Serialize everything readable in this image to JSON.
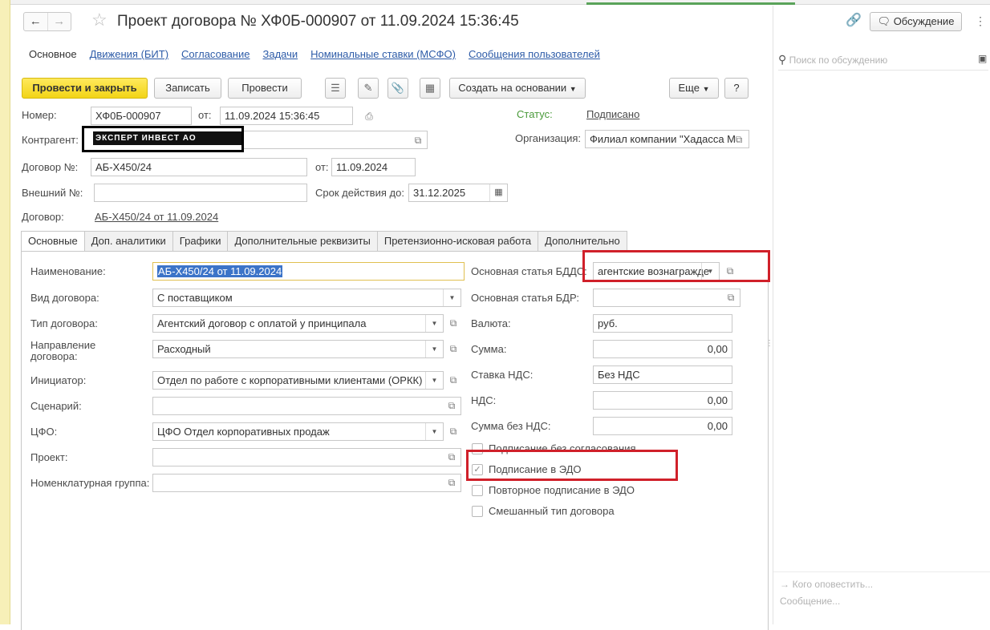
{
  "window": {
    "title": "Проект договора № ХФ0Б-000907 от 11.09.2024 15:36:45",
    "discussion_button": "Обсуждение"
  },
  "section_tabs": [
    {
      "label": "Основное"
    },
    {
      "label": "Движения (БИТ)"
    },
    {
      "label": "Согласование"
    },
    {
      "label": "Задачи"
    },
    {
      "label": "Номинальные ставки (МСФО)"
    },
    {
      "label": "Сообщения пользователей"
    }
  ],
  "toolbar": {
    "post_and_close": "Провести и закрыть",
    "save": "Записать",
    "post": "Провести",
    "create_based_on": "Создать на основании",
    "more": "Еще",
    "help": "?"
  },
  "header": {
    "number_label": "Номер:",
    "number_value": "ХФ0Б-000907",
    "from_label": "от:",
    "date_value": "11.09.2024 15:36:45",
    "status_label": "Статус:",
    "status_value": "Подписано",
    "counterparty_label": "Контрагент:",
    "counterparty_value": "ЭКСПЕРТ ИНВЕСТ АО",
    "organization_label": "Организация:",
    "organization_value": "Филиал компании \"Хадасса М",
    "contract_no_label": "Договор №:",
    "contract_no_value": "АБ-Х450/24",
    "contract_date_label": "от:",
    "contract_date_value": "11.09.2024",
    "external_no_label": "Внешний №:",
    "external_no_value": "",
    "valid_until_label": "Срок действия до:",
    "valid_until_value": "31.12.2025",
    "contract_label": "Договор:",
    "contract_link": "АБ-Х450/24 от 11.09.2024"
  },
  "form_tabs": [
    {
      "label": "Основные"
    },
    {
      "label": "Доп. аналитики"
    },
    {
      "label": "Графики"
    },
    {
      "label": "Дополнительные реквизиты"
    },
    {
      "label": "Претензионно-исковая работа"
    },
    {
      "label": "Дополнительно"
    }
  ],
  "left_fields": {
    "name_label": "Наименование:",
    "name_value": "АБ-Х450/24 от 11.09.2024",
    "kind_label": "Вид договора:",
    "kind_value": "С поставщиком",
    "type_label": "Тип договора:",
    "type_value": "Агентский договор с оплатой у принципала",
    "direction_label": "Направление договора:",
    "direction_value": "Расходный",
    "initiator_label": "Инициатор:",
    "initiator_value": "Отдел по работе с корпоративными клиентами (ОРКК)",
    "scenario_label": "Сценарий:",
    "scenario_value": "",
    "cfo_label": "ЦФО:",
    "cfo_value": "ЦФО Отдел корпоративных продаж",
    "project_label": "Проект:",
    "project_value": "",
    "nomgroup_label": "Номенклатурная группа:",
    "nomgroup_value": ""
  },
  "right_fields": {
    "bdds_label": "Основная статья БДДС:",
    "bdds_value": "агентские вознагражде",
    "bdr_label": "Основная статья БДР:",
    "bdr_value": "",
    "currency_label": "Валюта:",
    "currency_value": "руб.",
    "sum_label": "Сумма:",
    "sum_value": "0,00",
    "vat_rate_label": "Ставка НДС:",
    "vat_rate_value": "Без НДС",
    "vat_label": "НДС:",
    "vat_value": "0,00",
    "sum_no_vat_label": "Сумма без НДС:",
    "sum_no_vat_value": "0,00"
  },
  "checkboxes": [
    {
      "label": "Подписание без согласования",
      "checked": false
    },
    {
      "label": "Подписание в ЭДО",
      "checked": true
    },
    {
      "label": "Повторное подписание в ЭДО",
      "checked": false
    },
    {
      "label": "Смешанный тип договора",
      "checked": false
    }
  ],
  "discussion": {
    "search_placeholder": "Поиск по обсуждению",
    "notify_placeholder": "Кого оповестить...",
    "message_placeholder": "Сообщение..."
  },
  "colors": {
    "accent_yellow": "#f2d416",
    "link_blue": "#2e5ca8",
    "highlight_red": "#d0202a"
  }
}
